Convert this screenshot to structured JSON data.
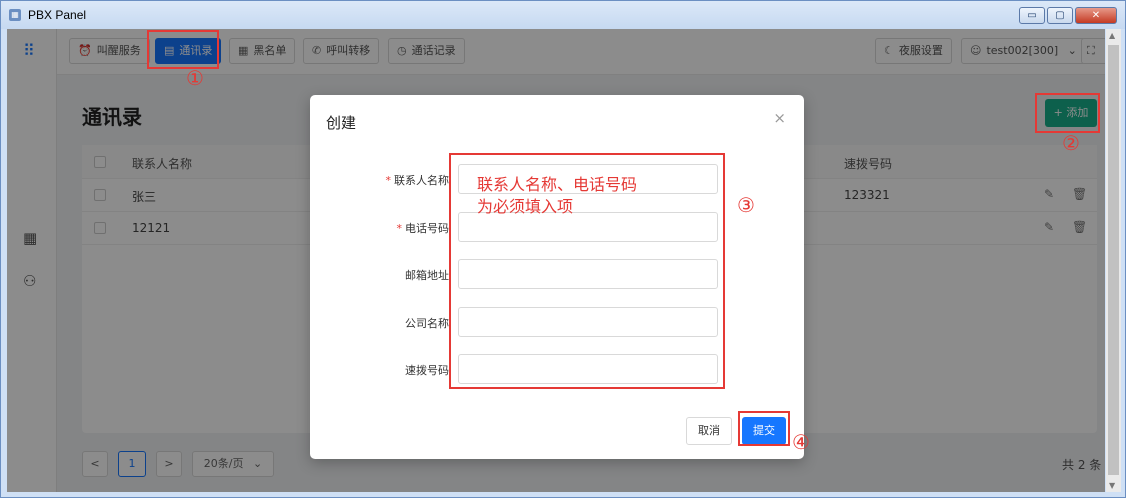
{
  "window": {
    "title": "PBX Panel",
    "controls": [
      "▭",
      "▢",
      "✕"
    ]
  },
  "topbar": {
    "nav": [
      {
        "label": "叫醒服务",
        "icon": "alarm-clock-icon",
        "glyph": "⏰"
      },
      {
        "label": "通讯录",
        "icon": "contact-book-icon",
        "glyph": "▤"
      },
      {
        "label": "黑名单",
        "icon": "grid-icon",
        "glyph": "▦"
      },
      {
        "label": "呼叫转移",
        "icon": "phone-forward-icon",
        "glyph": "✆"
      },
      {
        "label": "通话记录",
        "icon": "clock-icon",
        "glyph": "◷"
      }
    ],
    "night_mode": {
      "label": "夜服设置",
      "glyph": "☾"
    },
    "user": {
      "label": "test002[300]",
      "glyph": "☺",
      "caret": "⌄"
    },
    "fullscreen_glyph": "⛶"
  },
  "sidebar": {
    "logo_glyph": "⠿",
    "apps_glyph": "▦",
    "users_glyph": "⚇"
  },
  "page": {
    "title": "通讯录",
    "add_button": "+ 添加"
  },
  "table": {
    "columns": [
      "联系人名称",
      "速拨号码"
    ],
    "rows": [
      {
        "name": "张三",
        "speed_dial": "123321"
      },
      {
        "name": "12121",
        "speed_dial": ""
      }
    ],
    "edit_glyph": "✎",
    "delete_glyph": "🗑"
  },
  "pagination": {
    "prev": "<",
    "current": "1",
    "next": ">",
    "page_size": "20条/页",
    "total": "共 2 条"
  },
  "modal": {
    "title": "创建",
    "close_glyph": "×",
    "fields": [
      {
        "label": "联系人名称",
        "required": true,
        "value": ""
      },
      {
        "label": "电话号码",
        "required": true,
        "value": ""
      },
      {
        "label": "邮箱地址",
        "required": false,
        "value": ""
      },
      {
        "label": "公司名称",
        "required": false,
        "value": ""
      },
      {
        "label": "速拨号码",
        "required": false,
        "value": ""
      }
    ],
    "cancel": "取消",
    "submit": "提交"
  },
  "annotations": {
    "n1": "①",
    "n2": "②",
    "n3": "③",
    "n4": "④",
    "note_line1": "联系人名称、电话号码",
    "note_line2": "为必须填入项",
    "color": "#e53935"
  },
  "colors": {
    "primary": "#1677ff",
    "add": "#18b08b",
    "annotation": "#e53935"
  }
}
